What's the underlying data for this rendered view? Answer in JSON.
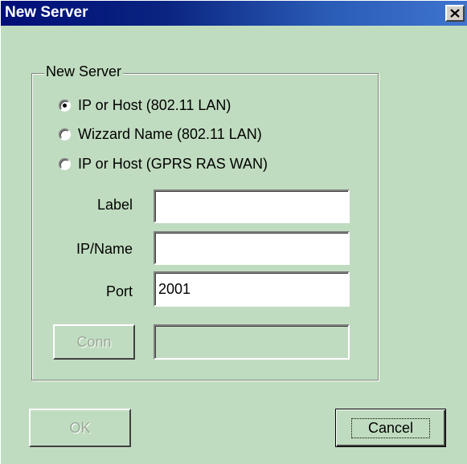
{
  "window": {
    "title": "New Server"
  },
  "group": {
    "legend": "New Server"
  },
  "radios": [
    {
      "label": "IP or Host (802.11 LAN)",
      "checked": true
    },
    {
      "label": "Wizzard Name (802.11 LAN)",
      "checked": false
    },
    {
      "label": "IP or Host (GPRS RAS WAN)",
      "checked": false
    }
  ],
  "fields": {
    "label": {
      "label": "Label",
      "value": ""
    },
    "ipname": {
      "label": "IP/Name",
      "value": ""
    },
    "port": {
      "label": "Port",
      "value": "2001"
    },
    "conn_status": {
      "value": ""
    }
  },
  "buttons": {
    "conn": "Conn",
    "ok": "OK",
    "cancel": "Cancel"
  },
  "icons": {
    "close": "close-icon",
    "radio": "radio-icon"
  },
  "colors": {
    "dialog_bg": "#c0dcc0",
    "title_start": "#000e78",
    "title_end": "#3f74cf"
  }
}
